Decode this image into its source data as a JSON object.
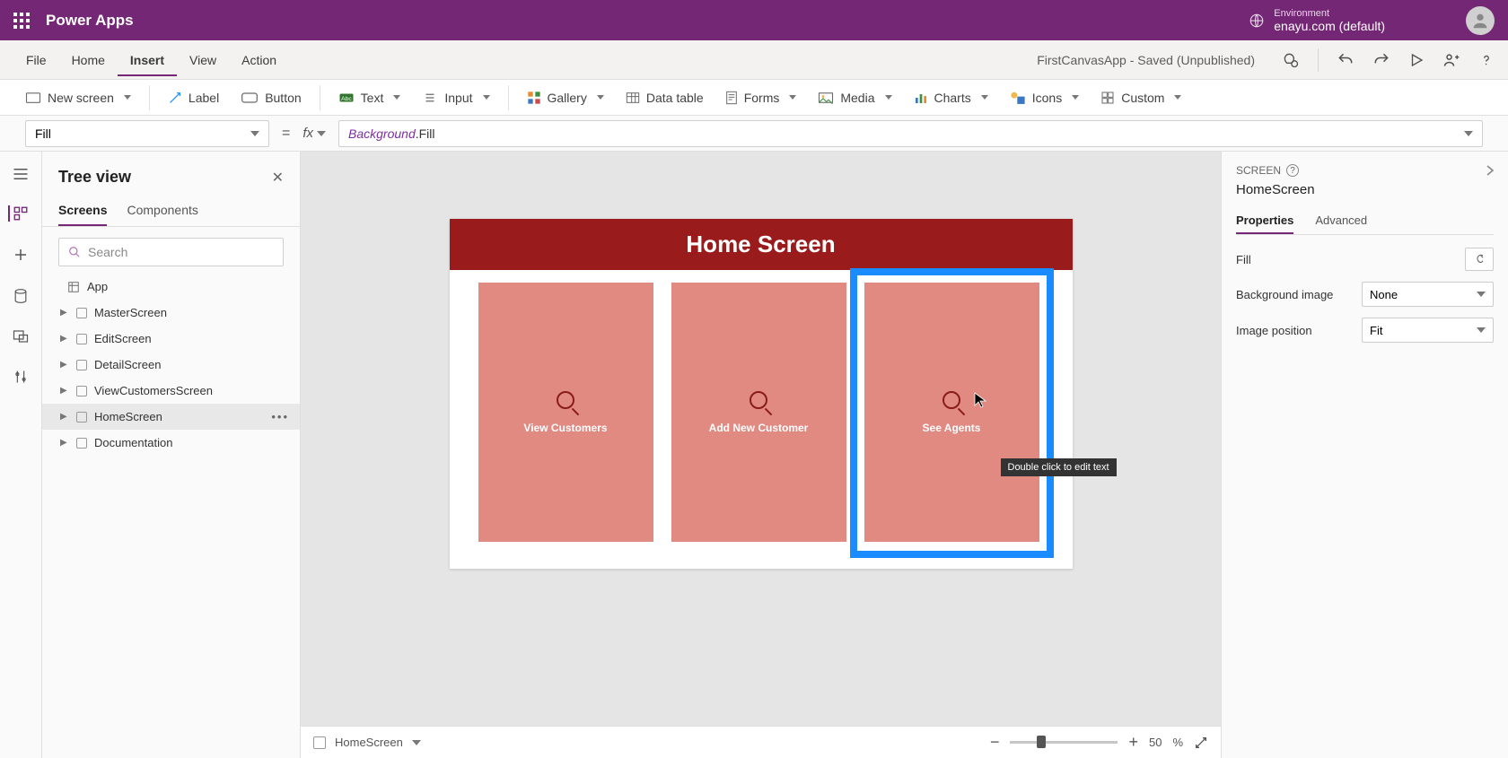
{
  "header": {
    "brand": "Power Apps",
    "env_label": "Environment",
    "env_value": "enayu.com (default)"
  },
  "menubar": {
    "items": [
      "File",
      "Home",
      "Insert",
      "View",
      "Action"
    ],
    "active": "Insert",
    "app_status": "FirstCanvasApp - Saved (Unpublished)"
  },
  "ribbon": {
    "new_screen": "New screen",
    "label": "Label",
    "button": "Button",
    "text": "Text",
    "input": "Input",
    "gallery": "Gallery",
    "data_table": "Data table",
    "forms": "Forms",
    "media": "Media",
    "charts": "Charts",
    "icons": "Icons",
    "custom": "Custom"
  },
  "formula": {
    "property": "Fill",
    "eq": "=",
    "fx": "fx",
    "expr_obj": "Background",
    "expr_prop": ".Fill"
  },
  "tree": {
    "title": "Tree view",
    "tabs": {
      "screens": "Screens",
      "components": "Components"
    },
    "search_placeholder": "Search",
    "app_label": "App",
    "items": [
      {
        "label": "MasterScreen"
      },
      {
        "label": "EditScreen"
      },
      {
        "label": "DetailScreen"
      },
      {
        "label": "ViewCustomersScreen"
      },
      {
        "label": "HomeScreen",
        "selected": true
      },
      {
        "label": "Documentation"
      }
    ]
  },
  "canvas": {
    "header": "Home Screen",
    "cards": [
      {
        "label": "View Customers"
      },
      {
        "label": "Add New Customer"
      },
      {
        "label": "See Agents",
        "selected": true
      }
    ],
    "tooltip": "Double click to edit text"
  },
  "status": {
    "screen": "HomeScreen",
    "zoom_value": "50",
    "zoom_unit": "%"
  },
  "props": {
    "section_label": "SCREEN",
    "title": "HomeScreen",
    "tabs": {
      "properties": "Properties",
      "advanced": "Advanced"
    },
    "fill_label": "Fill",
    "bg_image_label": "Background image",
    "bg_image_value": "None",
    "img_pos_label": "Image position",
    "img_pos_value": "Fit"
  }
}
